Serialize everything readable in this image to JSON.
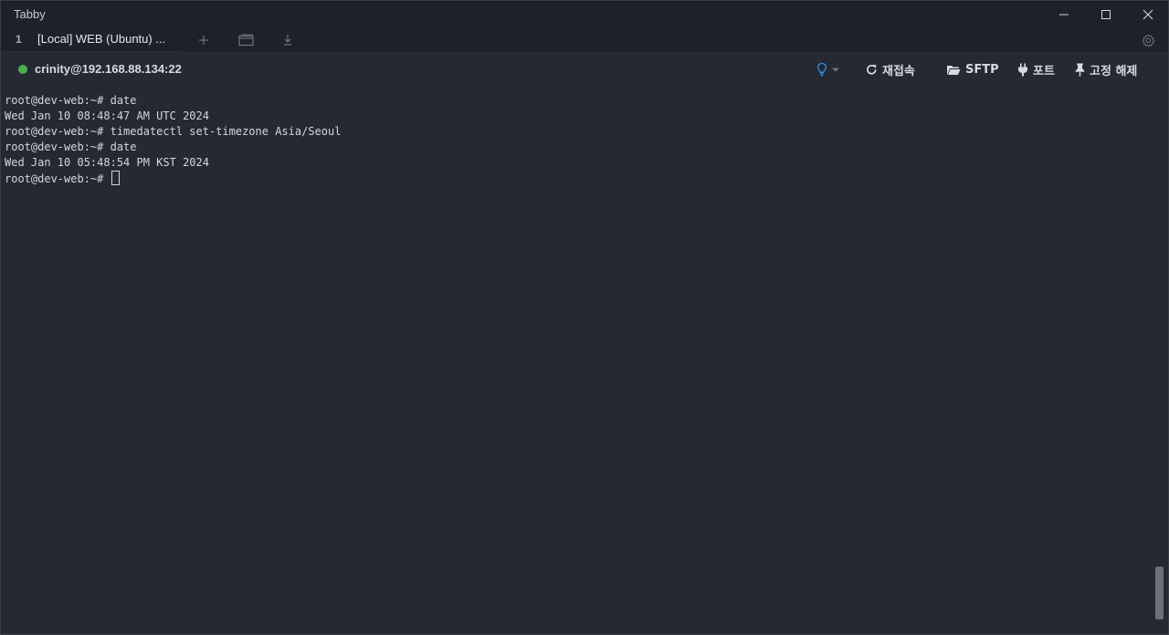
{
  "window": {
    "title": "Tabby"
  },
  "tabs": [
    {
      "index": "1",
      "label": "[Local] WEB (Ubuntu) ..."
    }
  ],
  "connection": {
    "host": "crinity@192.168.88.134:22",
    "status_color": "#4caf50"
  },
  "toolbar": {
    "reconnect_label": "재접속",
    "sftp_label": "SFTP",
    "ports_label": "포트",
    "unpin_label": "고정 해제"
  },
  "terminal": {
    "lines": [
      "root@dev-web:~# date",
      "Wed Jan 10 08:48:47 AM UTC 2024",
      "root@dev-web:~# timedatectl set-timezone Asia/Seoul",
      "root@dev-web:~# date",
      "Wed Jan 10 05:48:54 PM KST 2024"
    ],
    "prompt": "root@dev-web:~# "
  },
  "icons": {
    "minimize": "minimize-icon",
    "maximize": "maximize-icon",
    "close": "close-icon",
    "new_tab": "plus-icon",
    "window": "window-icon",
    "download": "download-icon",
    "settings": "gear-icon",
    "hint": "lightbulb-icon",
    "reconnect": "refresh-icon",
    "sftp": "folder-icon",
    "ports": "plug-icon",
    "unpin": "pin-icon"
  },
  "colors": {
    "background": "#242932",
    "titlebar": "#1d2128",
    "accent_blue": "#2f8fe0",
    "text": "#d4d7dc"
  }
}
